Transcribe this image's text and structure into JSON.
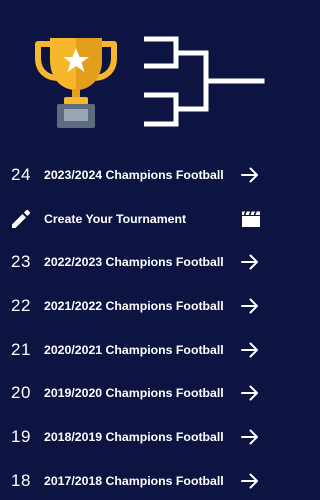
{
  "menu": {
    "create_tournament": {
      "label": "Create Your Tournament",
      "leading_icon": "pencil-icon",
      "trailing_icon": "clapperboard-icon"
    },
    "seasons": [
      {
        "number": "24",
        "label": "2023/2024 Champions Football"
      },
      {
        "number": "23",
        "label": "2022/2023 Champions Football"
      },
      {
        "number": "22",
        "label": "2021/2022 Champions Football"
      },
      {
        "number": "21",
        "label": "2020/2021 Champions Football"
      },
      {
        "number": "20",
        "label": "2019/2020 Champions Football"
      },
      {
        "number": "19",
        "label": "2018/2019 Champions Football"
      },
      {
        "number": "18",
        "label": "2017/2018 Champions Football"
      }
    ],
    "trailing_icon": "arrow-right-icon"
  },
  "colors": {
    "background": "#0d1442",
    "text": "#ffffff",
    "trophy_gold": "#f6b72c",
    "trophy_gold_dark": "#e39e1b",
    "trophy_base": "#5d6b7e",
    "trophy_plate": "#9aa6b4"
  }
}
